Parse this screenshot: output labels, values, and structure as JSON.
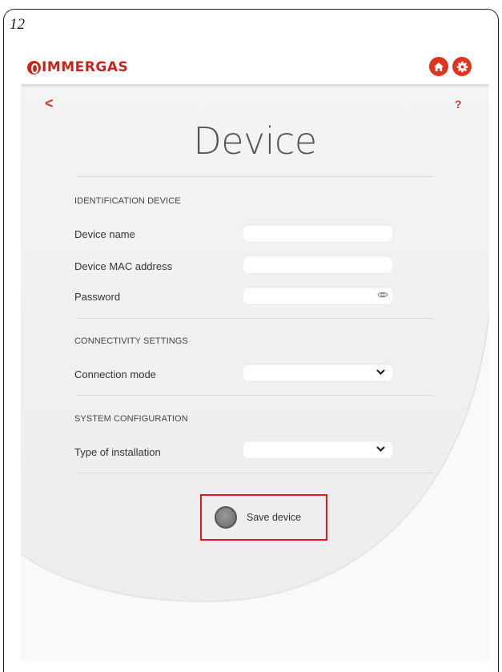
{
  "page_number": "12",
  "header": {
    "logo_text": "IMMERGAS",
    "home_icon": "home-icon",
    "settings_icon": "gear-icon",
    "accent_color": "#e0341e"
  },
  "nav": {
    "back_label": "<",
    "help_label": "?"
  },
  "page_title": "Device",
  "sections": {
    "identification": {
      "header": "IDENTIFICATION DEVICE",
      "device_name": {
        "label": "Device name",
        "value": ""
      },
      "mac_address": {
        "label": "Device MAC address",
        "value": ""
      },
      "password": {
        "label": "Password",
        "value": "",
        "icon": "eye-icon"
      }
    },
    "connectivity": {
      "header": "CONNECTIVITY SETTINGS",
      "connection_mode": {
        "label": "Connection mode",
        "selected": ""
      }
    },
    "system": {
      "header": "SYSTEM CONFIGURATION",
      "installation_type": {
        "label": "Type of installation",
        "selected": ""
      }
    }
  },
  "save": {
    "label": "Save device",
    "highlight_color": "#e01818"
  }
}
